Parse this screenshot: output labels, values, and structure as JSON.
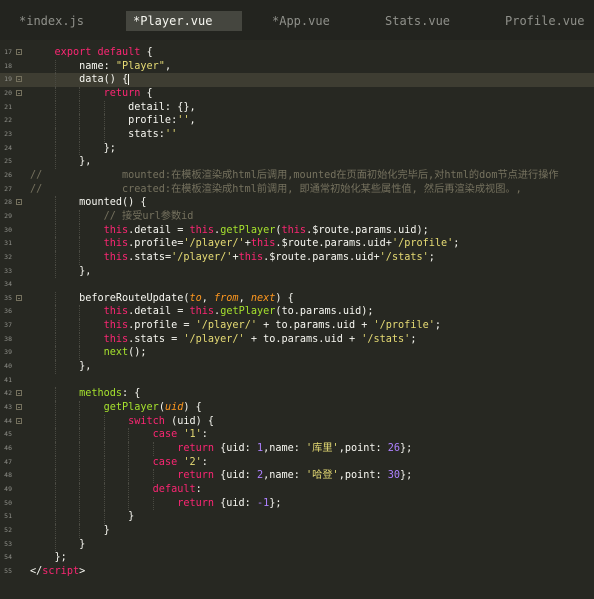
{
  "tabs": [
    {
      "label": "*index.js",
      "active": false
    },
    {
      "label": "*Player.vue",
      "active": true
    },
    {
      "label": "*App.vue",
      "active": false
    },
    {
      "label": "Stats.vue",
      "active": false
    },
    {
      "label": "Profile.vue",
      "active": false
    }
  ],
  "colors": {
    "background": "#272822",
    "keyword": "#f92672",
    "string": "#e6db74",
    "number": "#ae81ff",
    "function": "#a6e22e",
    "comment": "#75715e",
    "parameter": "#fd971f"
  },
  "current_line": 19,
  "lines": [
    {
      "num": "17",
      "fold": true,
      "segs": [
        {
          "t": "    "
        },
        {
          "t": "export",
          "c": "k"
        },
        {
          "t": " "
        },
        {
          "t": "default",
          "c": "k"
        },
        {
          "t": " {"
        }
      ]
    },
    {
      "num": "18",
      "fold": false,
      "segs": [
        {
          "t": "        name: "
        },
        {
          "t": "\"Player\"",
          "c": "s"
        },
        {
          "t": ","
        }
      ]
    },
    {
      "num": "19",
      "fold": true,
      "segs": [
        {
          "t": "        data() {"
        }
      ]
    },
    {
      "num": "20",
      "fold": true,
      "segs": [
        {
          "t": "            "
        },
        {
          "t": "return",
          "c": "k"
        },
        {
          "t": " {"
        }
      ]
    },
    {
      "num": "21",
      "fold": false,
      "segs": [
        {
          "t": "                detail: {},"
        }
      ]
    },
    {
      "num": "22",
      "fold": false,
      "segs": [
        {
          "t": "                profile:"
        },
        {
          "t": "''",
          "c": "s"
        },
        {
          "t": ","
        }
      ]
    },
    {
      "num": "23",
      "fold": false,
      "segs": [
        {
          "t": "                stats:"
        },
        {
          "t": "''",
          "c": "s"
        }
      ]
    },
    {
      "num": "24",
      "fold": false,
      "segs": [
        {
          "t": "            };"
        }
      ]
    },
    {
      "num": "25",
      "fold": false,
      "segs": [
        {
          "t": "        },"
        }
      ]
    },
    {
      "num": "26",
      "fold": false,
      "segs": [
        {
          "t": "//             mounted:在模板渲染成html后调用,mounted在页面初始化完毕后,对html的dom节点进行操作",
          "c": "c"
        }
      ]
    },
    {
      "num": "27",
      "fold": false,
      "segs": [
        {
          "t": "//             created:在模板渲染成html前调用, 即通常初始化某些属性值, 然后再渲染成视图。,",
          "c": "c"
        }
      ]
    },
    {
      "num": "28",
      "fold": true,
      "segs": [
        {
          "t": "        mounted() {"
        }
      ]
    },
    {
      "num": "29",
      "fold": false,
      "segs": [
        {
          "t": "            "
        },
        {
          "t": "// 接受url参数id",
          "c": "c"
        }
      ]
    },
    {
      "num": "30",
      "fold": false,
      "segs": [
        {
          "t": "            "
        },
        {
          "t": "this",
          "c": "k"
        },
        {
          "t": ".detail = "
        },
        {
          "t": "this",
          "c": "k"
        },
        {
          "t": "."
        },
        {
          "t": "getPlayer",
          "c": "f"
        },
        {
          "t": "("
        },
        {
          "t": "this",
          "c": "k"
        },
        {
          "t": ".$route.params.uid);"
        }
      ]
    },
    {
      "num": "31",
      "fold": false,
      "segs": [
        {
          "t": "            "
        },
        {
          "t": "this",
          "c": "k"
        },
        {
          "t": ".profile="
        },
        {
          "t": "'/player/'",
          "c": "s"
        },
        {
          "t": "+"
        },
        {
          "t": "this",
          "c": "k"
        },
        {
          "t": ".$route.params.uid+"
        },
        {
          "t": "'/profile'",
          "c": "s"
        },
        {
          "t": ";"
        }
      ]
    },
    {
      "num": "32",
      "fold": false,
      "segs": [
        {
          "t": "            "
        },
        {
          "t": "this",
          "c": "k"
        },
        {
          "t": ".stats="
        },
        {
          "t": "'/player/'",
          "c": "s"
        },
        {
          "t": "+"
        },
        {
          "t": "this",
          "c": "k"
        },
        {
          "t": ".$route.params.uid+"
        },
        {
          "t": "'/stats'",
          "c": "s"
        },
        {
          "t": ";"
        }
      ]
    },
    {
      "num": "33",
      "fold": false,
      "segs": [
        {
          "t": "        },"
        }
      ]
    },
    {
      "num": "34",
      "fold": false,
      "segs": [
        {
          "t": ""
        }
      ]
    },
    {
      "num": "35",
      "fold": true,
      "segs": [
        {
          "t": "        beforeRouteUpdate("
        },
        {
          "t": "to",
          "c": "p"
        },
        {
          "t": ", "
        },
        {
          "t": "from",
          "c": "p"
        },
        {
          "t": ", "
        },
        {
          "t": "next",
          "c": "p"
        },
        {
          "t": ") {"
        }
      ]
    },
    {
      "num": "36",
      "fold": false,
      "segs": [
        {
          "t": "            "
        },
        {
          "t": "this",
          "c": "k"
        },
        {
          "t": ".detail = "
        },
        {
          "t": "this",
          "c": "k"
        },
        {
          "t": "."
        },
        {
          "t": "getPlayer",
          "c": "f"
        },
        {
          "t": "(to.params.uid);"
        }
      ]
    },
    {
      "num": "37",
      "fold": false,
      "segs": [
        {
          "t": "            "
        },
        {
          "t": "this",
          "c": "k"
        },
        {
          "t": ".profile = "
        },
        {
          "t": "'/player/'",
          "c": "s"
        },
        {
          "t": " + to.params.uid + "
        },
        {
          "t": "'/profile'",
          "c": "s"
        },
        {
          "t": ";"
        }
      ]
    },
    {
      "num": "38",
      "fold": false,
      "segs": [
        {
          "t": "            "
        },
        {
          "t": "this",
          "c": "k"
        },
        {
          "t": ".stats = "
        },
        {
          "t": "'/player/'",
          "c": "s"
        },
        {
          "t": " + to.params.uid + "
        },
        {
          "t": "'/stats'",
          "c": "s"
        },
        {
          "t": ";"
        }
      ]
    },
    {
      "num": "39",
      "fold": false,
      "segs": [
        {
          "t": "            "
        },
        {
          "t": "next",
          "c": "f"
        },
        {
          "t": "();"
        }
      ]
    },
    {
      "num": "40",
      "fold": false,
      "segs": [
        {
          "t": "        },"
        }
      ]
    },
    {
      "num": "41",
      "fold": false,
      "segs": [
        {
          "t": ""
        }
      ]
    },
    {
      "num": "42",
      "fold": true,
      "segs": [
        {
          "t": "        "
        },
        {
          "t": "methods",
          "c": "f"
        },
        {
          "t": ": {"
        }
      ]
    },
    {
      "num": "43",
      "fold": true,
      "segs": [
        {
          "t": "            "
        },
        {
          "t": "getPlayer",
          "c": "f"
        },
        {
          "t": "("
        },
        {
          "t": "uid",
          "c": "p"
        },
        {
          "t": ") {"
        }
      ]
    },
    {
      "num": "44",
      "fold": true,
      "segs": [
        {
          "t": "                "
        },
        {
          "t": "switch",
          "c": "k"
        },
        {
          "t": " (uid) {"
        }
      ]
    },
    {
      "num": "45",
      "fold": false,
      "segs": [
        {
          "t": "                    "
        },
        {
          "t": "case",
          "c": "k"
        },
        {
          "t": " "
        },
        {
          "t": "'1'",
          "c": "s"
        },
        {
          "t": ":"
        }
      ]
    },
    {
      "num": "46",
      "fold": false,
      "segs": [
        {
          "t": "                        "
        },
        {
          "t": "return",
          "c": "k"
        },
        {
          "t": " {uid: "
        },
        {
          "t": "1",
          "c": "n"
        },
        {
          "t": ",name: "
        },
        {
          "t": "'库里'",
          "c": "s"
        },
        {
          "t": ",point: "
        },
        {
          "t": "26",
          "c": "n"
        },
        {
          "t": "};"
        }
      ]
    },
    {
      "num": "47",
      "fold": false,
      "segs": [
        {
          "t": "                    "
        },
        {
          "t": "case",
          "c": "k"
        },
        {
          "t": " "
        },
        {
          "t": "'2'",
          "c": "s"
        },
        {
          "t": ":"
        }
      ]
    },
    {
      "num": "48",
      "fold": false,
      "segs": [
        {
          "t": "                        "
        },
        {
          "t": "return",
          "c": "k"
        },
        {
          "t": " {uid: "
        },
        {
          "t": "2",
          "c": "n"
        },
        {
          "t": ",name: "
        },
        {
          "t": "'哈登'",
          "c": "s"
        },
        {
          "t": ",point: "
        },
        {
          "t": "30",
          "c": "n"
        },
        {
          "t": "};"
        }
      ]
    },
    {
      "num": "49",
      "fold": false,
      "segs": [
        {
          "t": "                    "
        },
        {
          "t": "default",
          "c": "k"
        },
        {
          "t": ":"
        }
      ]
    },
    {
      "num": "50",
      "fold": false,
      "segs": [
        {
          "t": "                        "
        },
        {
          "t": "return",
          "c": "k"
        },
        {
          "t": " {uid: "
        },
        {
          "t": "-1",
          "c": "n"
        },
        {
          "t": "};"
        }
      ]
    },
    {
      "num": "51",
      "fold": false,
      "segs": [
        {
          "t": "                }"
        }
      ]
    },
    {
      "num": "52",
      "fold": false,
      "segs": [
        {
          "t": "            }"
        }
      ]
    },
    {
      "num": "53",
      "fold": false,
      "segs": [
        {
          "t": "        }"
        }
      ]
    },
    {
      "num": "54",
      "fold": false,
      "segs": [
        {
          "t": "    };"
        }
      ]
    },
    {
      "num": "55",
      "fold": false,
      "segs": [
        {
          "t": "</"
        },
        {
          "t": "script",
          "c": "t"
        },
        {
          "t": ">"
        }
      ]
    }
  ]
}
